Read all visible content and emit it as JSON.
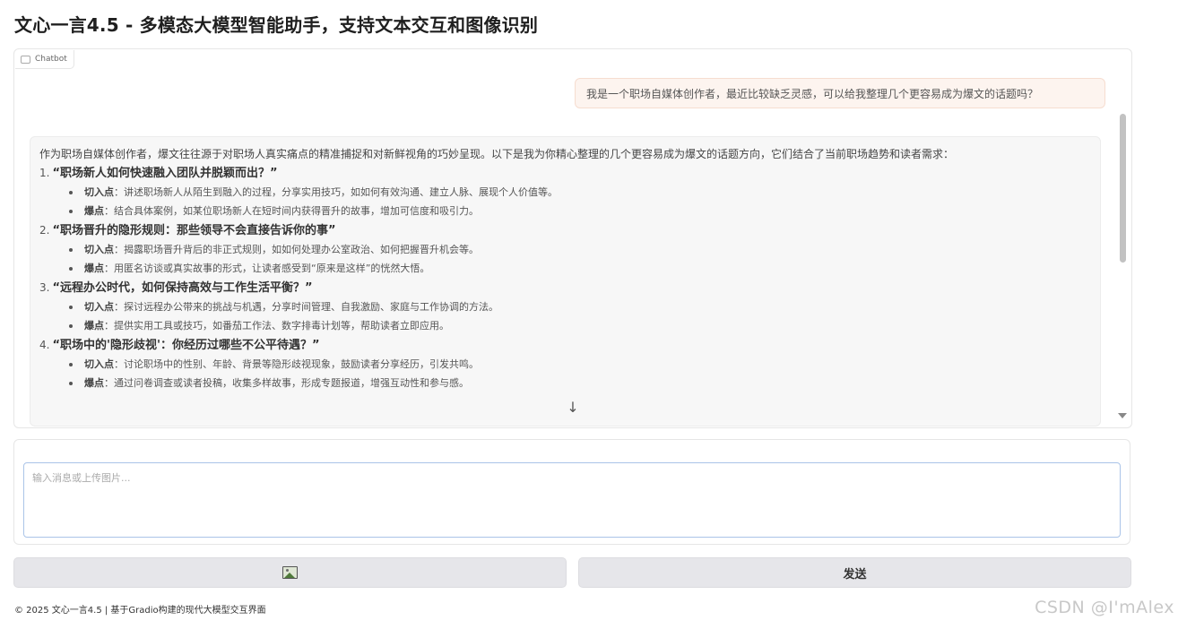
{
  "app": {
    "title": "文心一言4.5 - 多模态大模型智能助手，支持文本交互和图像识别"
  },
  "chatbot": {
    "label": "Chatbot",
    "user_message": "我是一个职场自媒体创作者，最近比较缺乏灵感，可以给我整理几个更容易成为爆文的话题吗？",
    "bot_intro": "作为职场自媒体创作者，爆文往往源于对职场人真实痛点的精准捕捉和对新鲜视角的巧妙呈现。以下是我为你精心整理的几个更容易成为爆文的话题方向，它们结合了当前职场趋势和读者需求：",
    "topics": [
      {
        "num": "1.",
        "title": "“职场新人如何快速融入团队并脱颖而出？”",
        "points": [
          {
            "key": "切入点",
            "text": "：讲述职场新人从陌生到融入的过程，分享实用技巧，如如何有效沟通、建立人脉、展现个人价值等。"
          },
          {
            "key": "爆点",
            "text": "：结合具体案例，如某位职场新人在短时间内获得晋升的故事，增加可信度和吸引力。"
          }
        ]
      },
      {
        "num": "2.",
        "title": "“职场晋升的隐形规则：那些领导不会直接告诉你的事”",
        "points": [
          {
            "key": "切入点",
            "text": "：揭露职场晋升背后的非正式规则，如如何处理办公室政治、如何把握晋升机会等。"
          },
          {
            "key": "爆点",
            "text": "：用匿名访谈或真实故事的形式，让读者感受到“原来是这样”的恍然大悟。"
          }
        ]
      },
      {
        "num": "3.",
        "title": "“远程办公时代，如何保持高效与工作生活平衡？”",
        "points": [
          {
            "key": "切入点",
            "text": "：探讨远程办公带来的挑战与机遇，分享时间管理、自我激励、家庭与工作协调的方法。"
          },
          {
            "key": "爆点",
            "text": "：提供实用工具或技巧，如番茄工作法、数字排毒计划等，帮助读者立即应用。"
          }
        ]
      },
      {
        "num": "4.",
        "title": "“职场中的'隐形歧视'：你经历过哪些不公平待遇？”",
        "points": [
          {
            "key": "切入点",
            "text": "：讨论职场中的性别、年龄、背景等隐形歧视现象，鼓励读者分享经历，引发共鸣。"
          },
          {
            "key": "爆点",
            "text": "：通过问卷调查或读者投稿，收集多样故事，形成专题报道，增强互动性和参与感。"
          }
        ]
      }
    ]
  },
  "input": {
    "placeholder": "输入消息或上传图片...",
    "value": ""
  },
  "buttons": {
    "image_icon": "image-icon",
    "send_label": "发送"
  },
  "footer": {
    "text": "© 2025 文心一言4.5 | 基于Gradio构建的现代大模型交互界面"
  },
  "watermark": "CSDN @I'mAlex"
}
